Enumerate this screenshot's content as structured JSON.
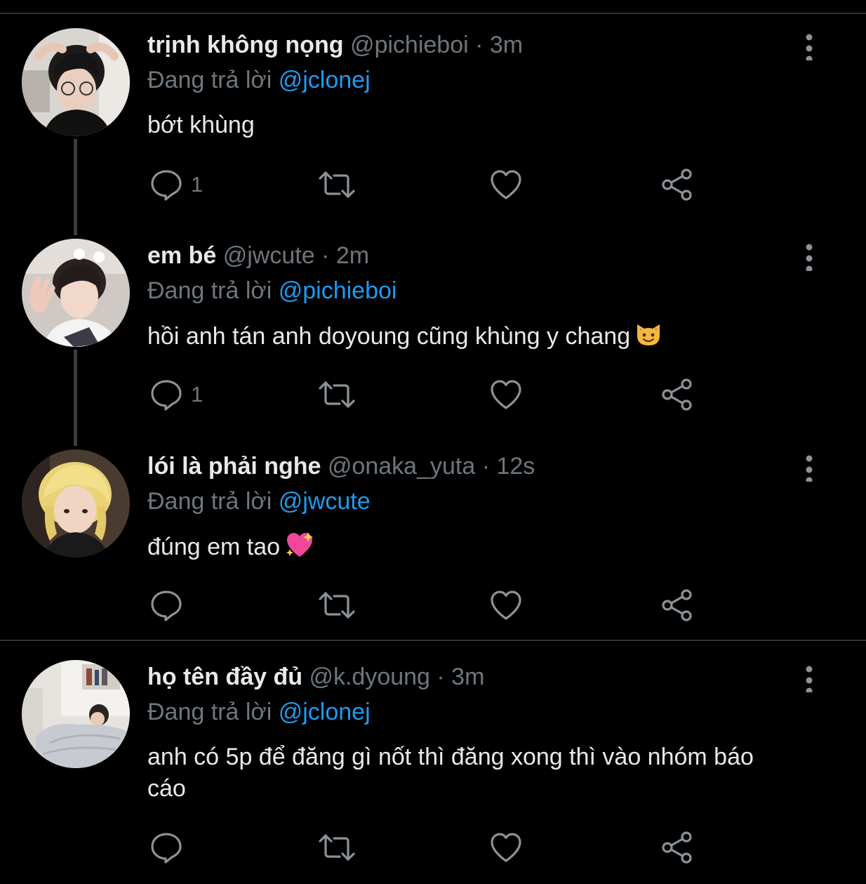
{
  "colors": {
    "background": "#000000",
    "text": "#e7e9ea",
    "muted": "#6e767d",
    "accent": "#1d9bf0",
    "divider": "#2f3336",
    "thread_line": "#3a3e42"
  },
  "tweets": [
    {
      "display_name": "trịnh không nọng",
      "handle_time": "@pichieboi · 3m",
      "reply_prefix": "Đang trả lời",
      "reply_to": "@jclonej",
      "text": "bớt khùng",
      "reply_count": "1",
      "icons": [
        "avatar",
        "more-vertical-icon",
        "reply-icon",
        "retweet-icon",
        "like-icon",
        "share-icon"
      ]
    },
    {
      "display_name": "em bé",
      "handle_time": "@jwcute · 2m",
      "reply_prefix": "Đang trả lời",
      "reply_to": "@pichieboi",
      "text": "hồi anh tán anh doyoung cũng khùng y chang",
      "emoji": "smiling-cat-emoji",
      "reply_count": "1"
    },
    {
      "display_name": "lói là phải nghe",
      "handle_time": "@onaka_yuta · 12s",
      "reply_prefix": "Đang trả lời",
      "reply_to": "@jwcute",
      "text": "đúng em tao",
      "emoji": "sparkling-heart-emoji",
      "reply_count": ""
    },
    {
      "display_name": "họ tên đầy đủ",
      "handle_time": "@k.dyoung · 3m",
      "reply_prefix": "Đang trả lời",
      "reply_to": "@jclonej",
      "text": "anh có 5p để đăng gì nốt thì đăng xong thì vào nhóm báo cáo",
      "reply_count": ""
    }
  ]
}
